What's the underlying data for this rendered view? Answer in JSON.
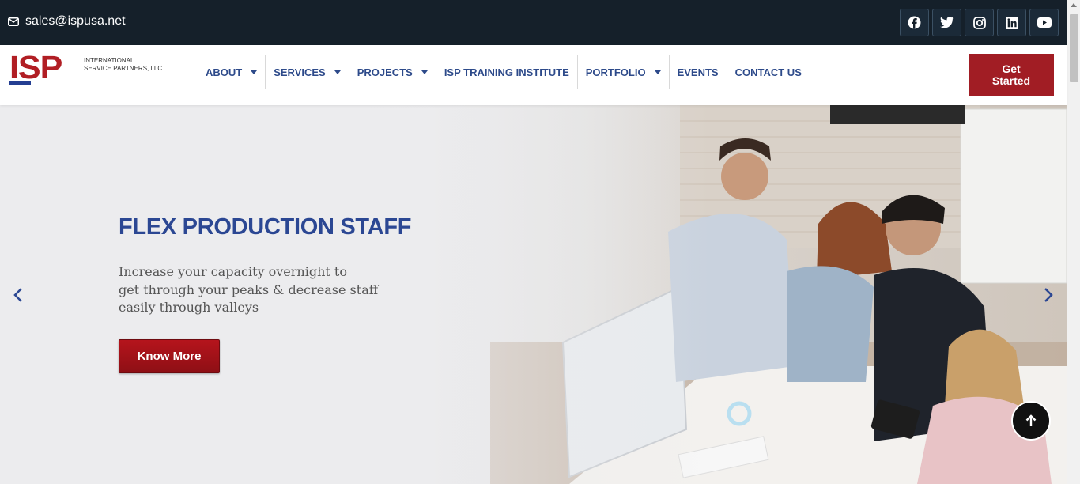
{
  "topbar": {
    "email": "sales@ispusa.net",
    "socials": [
      {
        "icon": "facebook-icon"
      },
      {
        "icon": "twitter-icon"
      },
      {
        "icon": "instagram-icon"
      },
      {
        "icon": "linkedin-icon"
      },
      {
        "icon": "youtube-icon"
      }
    ]
  },
  "header": {
    "logo": {
      "letters": "ISP",
      "line1": "International",
      "line2": "Service Partners, LLC"
    },
    "nav": [
      {
        "label": "ABOUT",
        "dropdown": true
      },
      {
        "label": "SERVICES",
        "dropdown": true
      },
      {
        "label": "PROJECTS",
        "dropdown": true
      },
      {
        "label": "ISP TRAINING INSTITUTE",
        "dropdown": false
      },
      {
        "label": "PORTFOLIO",
        "dropdown": true
      },
      {
        "label": "EVENTS",
        "dropdown": false
      },
      {
        "label": "CONTACT US",
        "dropdown": false
      }
    ],
    "cta_line1": "Get",
    "cta_line2": "Started"
  },
  "hero": {
    "title": "FLEX PRODUCTION STAFF",
    "lines": [
      "Increase your capacity overnight to",
      "get through your peaks & decrease staff",
      "easily through valleys"
    ],
    "button": "Know More"
  },
  "colors": {
    "topbar": "#15202a",
    "brand_red": "#a11d24",
    "nav_blue": "#2d4a8a",
    "title_blue": "#2b4793"
  }
}
